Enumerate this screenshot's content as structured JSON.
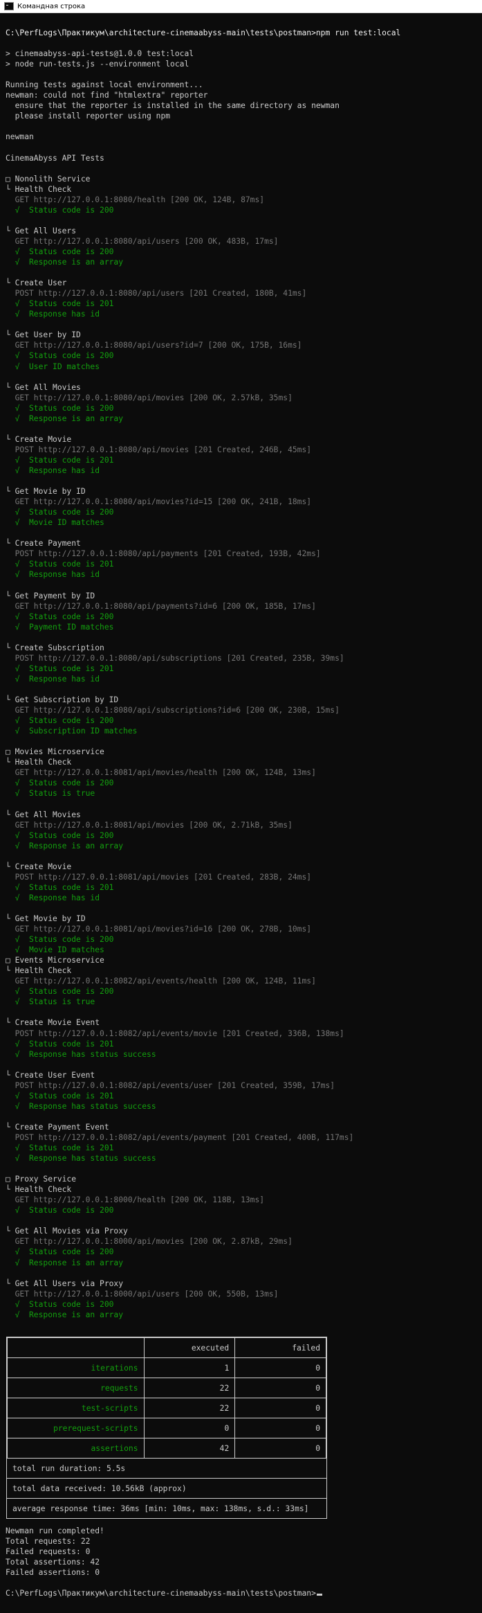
{
  "window": {
    "title": "Командная строка"
  },
  "lines": [
    {
      "t": "C:\\PerfLogs\\Практикум\\architecture-cinemaabyss-main\\tests\\postman>npm run test:local",
      "c": "white"
    },
    {
      "t": "",
      "c": ""
    },
    {
      "t": "> cinemaabyss-api-tests@1.0.0 test:local",
      "c": ""
    },
    {
      "t": "> node run-tests.js --environment local",
      "c": ""
    },
    {
      "t": "",
      "c": ""
    },
    {
      "t": "Running tests against local environment...",
      "c": ""
    },
    {
      "t": "newman: could not find \"htmlextra\" reporter",
      "c": ""
    },
    {
      "t": "  ensure that the reporter is installed in the same directory as newman",
      "c": ""
    },
    {
      "t": "  please install reporter using npm",
      "c": ""
    },
    {
      "t": "",
      "c": ""
    },
    {
      "t": "newman",
      "c": ""
    },
    {
      "t": "",
      "c": ""
    },
    {
      "t": "CinemaAbyss API Tests",
      "c": ""
    },
    {
      "t": "",
      "c": ""
    },
    {
      "t": "□ Nonolith Service",
      "c": ""
    },
    {
      "t": "└ Health Check",
      "c": ""
    },
    {
      "t": "  GET http://127.0.0.1:8080/health [200 OK, 124B, 87ms]",
      "c": "gray"
    },
    {
      "t": "  √  Status code is 200",
      "c": "green"
    },
    {
      "t": "",
      "c": ""
    },
    {
      "t": "└ Get All Users",
      "c": ""
    },
    {
      "t": "  GET http://127.0.0.1:8080/api/users [200 OK, 483B, 17ms]",
      "c": "gray"
    },
    {
      "t": "  √  Status code is 200",
      "c": "green"
    },
    {
      "t": "  √  Response is an array",
      "c": "green"
    },
    {
      "t": "",
      "c": ""
    },
    {
      "t": "└ Create User",
      "c": ""
    },
    {
      "t": "  POST http://127.0.0.1:8080/api/users [201 Created, 180B, 41ms]",
      "c": "gray"
    },
    {
      "t": "  √  Status code is 201",
      "c": "green"
    },
    {
      "t": "  √  Response has id",
      "c": "green"
    },
    {
      "t": "",
      "c": ""
    },
    {
      "t": "└ Get User by ID",
      "c": ""
    },
    {
      "t": "  GET http://127.0.0.1:8080/api/users?id=7 [200 OK, 175B, 16ms]",
      "c": "gray"
    },
    {
      "t": "  √  Status code is 200",
      "c": "green"
    },
    {
      "t": "  √  User ID matches",
      "c": "green"
    },
    {
      "t": "",
      "c": ""
    },
    {
      "t": "└ Get All Movies",
      "c": ""
    },
    {
      "t": "  GET http://127.0.0.1:8080/api/movies [200 OK, 2.57kB, 35ms]",
      "c": "gray"
    },
    {
      "t": "  √  Status code is 200",
      "c": "green"
    },
    {
      "t": "  √  Response is an array",
      "c": "green"
    },
    {
      "t": "",
      "c": ""
    },
    {
      "t": "└ Create Movie",
      "c": ""
    },
    {
      "t": "  POST http://127.0.0.1:8080/api/movies [201 Created, 246B, 45ms]",
      "c": "gray"
    },
    {
      "t": "  √  Status code is 201",
      "c": "green"
    },
    {
      "t": "  √  Response has id",
      "c": "green"
    },
    {
      "t": "",
      "c": ""
    },
    {
      "t": "└ Get Movie by ID",
      "c": ""
    },
    {
      "t": "  GET http://127.0.0.1:8080/api/movies?id=15 [200 OK, 241B, 18ms]",
      "c": "gray"
    },
    {
      "t": "  √  Status code is 200",
      "c": "green"
    },
    {
      "t": "  √  Movie ID matches",
      "c": "green"
    },
    {
      "t": "",
      "c": ""
    },
    {
      "t": "└ Create Payment",
      "c": ""
    },
    {
      "t": "  POST http://127.0.0.1:8080/api/payments [201 Created, 193B, 42ms]",
      "c": "gray"
    },
    {
      "t": "  √  Status code is 201",
      "c": "green"
    },
    {
      "t": "  √  Response has id",
      "c": "green"
    },
    {
      "t": "",
      "c": ""
    },
    {
      "t": "└ Get Payment by ID",
      "c": ""
    },
    {
      "t": "  GET http://127.0.0.1:8080/api/payments?id=6 [200 OK, 185B, 17ms]",
      "c": "gray"
    },
    {
      "t": "  √  Status code is 200",
      "c": "green"
    },
    {
      "t": "  √  Payment ID matches",
      "c": "green"
    },
    {
      "t": "",
      "c": ""
    },
    {
      "t": "└ Create Subscription",
      "c": ""
    },
    {
      "t": "  POST http://127.0.0.1:8080/api/subscriptions [201 Created, 235B, 39ms]",
      "c": "gray"
    },
    {
      "t": "  √  Status code is 201",
      "c": "green"
    },
    {
      "t": "  √  Response has id",
      "c": "green"
    },
    {
      "t": "",
      "c": ""
    },
    {
      "t": "└ Get Subscription by ID",
      "c": ""
    },
    {
      "t": "  GET http://127.0.0.1:8080/api/subscriptions?id=6 [200 OK, 230B, 15ms]",
      "c": "gray"
    },
    {
      "t": "  √  Status code is 200",
      "c": "green"
    },
    {
      "t": "  √  Subscription ID matches",
      "c": "green"
    },
    {
      "t": "",
      "c": ""
    },
    {
      "t": "□ Movies Microservice",
      "c": ""
    },
    {
      "t": "└ Health Check",
      "c": ""
    },
    {
      "t": "  GET http://127.0.0.1:8081/api/movies/health [200 OK, 124B, 13ms]",
      "c": "gray"
    },
    {
      "t": "  √  Status code is 200",
      "c": "green"
    },
    {
      "t": "  √  Status is true",
      "c": "green"
    },
    {
      "t": "",
      "c": ""
    },
    {
      "t": "└ Get All Movies",
      "c": ""
    },
    {
      "t": "  GET http://127.0.0.1:8081/api/movies [200 OK, 2.71kB, 35ms]",
      "c": "gray"
    },
    {
      "t": "  √  Status code is 200",
      "c": "green"
    },
    {
      "t": "  √  Response is an array",
      "c": "green"
    },
    {
      "t": "",
      "c": ""
    },
    {
      "t": "└ Create Movie",
      "c": ""
    },
    {
      "t": "  POST http://127.0.0.1:8081/api/movies [201 Created, 283B, 24ms]",
      "c": "gray"
    },
    {
      "t": "  √  Status code is 201",
      "c": "green"
    },
    {
      "t": "  √  Response has id",
      "c": "green"
    },
    {
      "t": "",
      "c": ""
    },
    {
      "t": "└ Get Movie by ID",
      "c": ""
    },
    {
      "t": "  GET http://127.0.0.1:8081/api/movies?id=16 [200 OK, 278B, 10ms]",
      "c": "gray"
    },
    {
      "t": "  √  Status code is 200",
      "c": "green"
    },
    {
      "t": "  √  Movie ID matches",
      "c": "green"
    },
    {
      "t": "□ Events Microservice",
      "c": ""
    },
    {
      "t": "└ Health Check",
      "c": ""
    },
    {
      "t": "  GET http://127.0.0.1:8082/api/events/health [200 OK, 124B, 11ms]",
      "c": "gray"
    },
    {
      "t": "  √  Status code is 200",
      "c": "green"
    },
    {
      "t": "  √  Status is true",
      "c": "green"
    },
    {
      "t": "",
      "c": ""
    },
    {
      "t": "└ Create Movie Event",
      "c": ""
    },
    {
      "t": "  POST http://127.0.0.1:8082/api/events/movie [201 Created, 336B, 138ms]",
      "c": "gray"
    },
    {
      "t": "  √  Status code is 201",
      "c": "green"
    },
    {
      "t": "  √  Response has status success",
      "c": "green"
    },
    {
      "t": "",
      "c": ""
    },
    {
      "t": "└ Create User Event",
      "c": ""
    },
    {
      "t": "  POST http://127.0.0.1:8082/api/events/user [201 Created, 359B, 17ms]",
      "c": "gray"
    },
    {
      "t": "  √  Status code is 201",
      "c": "green"
    },
    {
      "t": "  √  Response has status success",
      "c": "green"
    },
    {
      "t": "",
      "c": ""
    },
    {
      "t": "└ Create Payment Event",
      "c": ""
    },
    {
      "t": "  POST http://127.0.0.1:8082/api/events/payment [201 Created, 400B, 117ms]",
      "c": "gray"
    },
    {
      "t": "  √  Status code is 201",
      "c": "green"
    },
    {
      "t": "  √  Response has status success",
      "c": "green"
    },
    {
      "t": "",
      "c": ""
    },
    {
      "t": "□ Proxy Service",
      "c": ""
    },
    {
      "t": "└ Health Check",
      "c": ""
    },
    {
      "t": "  GET http://127.0.0.1:8000/health [200 OK, 118B, 13ms]",
      "c": "gray"
    },
    {
      "t": "  √  Status code is 200",
      "c": "green"
    },
    {
      "t": "",
      "c": ""
    },
    {
      "t": "└ Get All Movies via Proxy",
      "c": ""
    },
    {
      "t": "  GET http://127.0.0.1:8000/api/movies [200 OK, 2.87kB, 29ms]",
      "c": "gray"
    },
    {
      "t": "  √  Status code is 200",
      "c": "green"
    },
    {
      "t": "  √  Response is an array",
      "c": "green"
    },
    {
      "t": "",
      "c": ""
    },
    {
      "t": "└ Get All Users via Proxy",
      "c": ""
    },
    {
      "t": "  GET http://127.0.0.1:8000/api/users [200 OK, 550B, 13ms]",
      "c": "gray"
    },
    {
      "t": "  √  Status code is 200",
      "c": "green"
    },
    {
      "t": "  √  Response is an array",
      "c": "green"
    }
  ],
  "summary": {
    "headers": {
      "executed": "executed",
      "failed": "failed"
    },
    "rows": [
      {
        "label": "iterations",
        "executed": "1",
        "failed": "0"
      },
      {
        "label": "requests",
        "executed": "22",
        "failed": "0"
      },
      {
        "label": "test-scripts",
        "executed": "22",
        "failed": "0"
      },
      {
        "label": "prerequest-scripts",
        "executed": "0",
        "failed": "0"
      },
      {
        "label": "assertions",
        "executed": "42",
        "failed": "0"
      }
    ],
    "duration": "total run duration: 5.5s",
    "received": "total data received: 10.56kB (approx)",
    "response_time": "average response time: 36ms [min: 10ms, max: 138ms, s.d.: 33ms]"
  },
  "after": [
    "Newman run completed!",
    "Total requests: 22",
    "Failed requests: 0",
    "Total assertions: 42",
    "Failed assertions: 0",
    "",
    "C:\\PerfLogs\\Практикум\\architecture-cinemaabyss-main\\tests\\postman>"
  ],
  "colors": {
    "background": "#0c0c0c",
    "text": "#cccccc",
    "gray": "#767676",
    "green": "#13a10e"
  }
}
